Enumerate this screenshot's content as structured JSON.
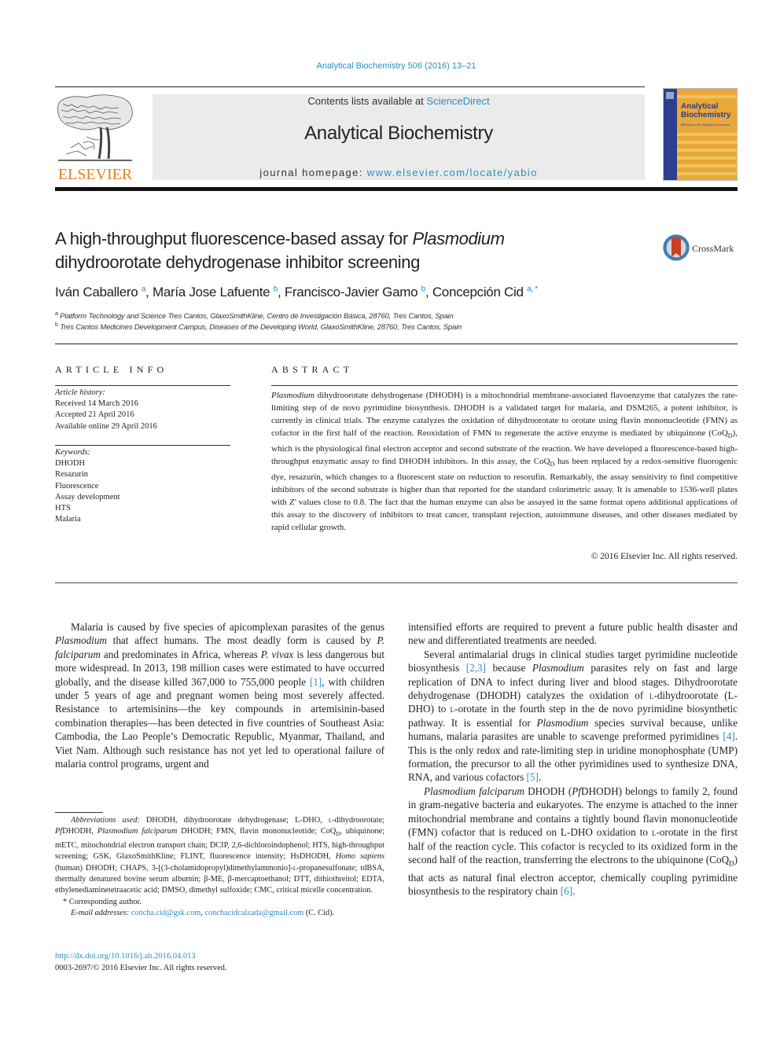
{
  "header": {
    "citation": "Analytical Biochemistry 506 (2016) 13–21",
    "publisher_logo_text": "ELSEVIER",
    "contents_prefix": "Contents lists available at ",
    "contents_link": "ScienceDirect",
    "journal_title": "Analytical Biochemistry",
    "homepage_prefix": "journal homepage: ",
    "homepage_link": "www.elsevier.com/locate/yabio",
    "cover": {
      "title_line1": "Analytical",
      "title_line2": "Biochemistry",
      "subtitle": "Methods in the Biological Sciences"
    }
  },
  "article": {
    "title_part1": "A high-throughput fluorescence-based assay for ",
    "title_italic": "Plasmodium",
    "title_part2": "dihydroorotate dehydrogenase inhibitor screening",
    "crossmark_label": "CrossMark",
    "authors": [
      {
        "name": "Iván Caballero",
        "sup": "a",
        "sep": ", "
      },
      {
        "name": "María Jose Lafuente",
        "sup": "b",
        "sep": ", "
      },
      {
        "name": "Francisco-Javier Gamo",
        "sup": "b",
        "sep": ", "
      },
      {
        "name": "Concepción Cid",
        "sup": "a, *",
        "sep": ""
      }
    ],
    "affiliations": [
      {
        "mark": "a",
        "text": "Platform Technology and Science Tres Cantos, GlaxoSmithKline, Centro de Investigación Básica, 28760, Tres Cantos, Spain"
      },
      {
        "mark": "b",
        "text": "Tres Cantos Medicines Development Campus, Diseases of the Developing World, GlaxoSmithKline, 28760, Tres Cantos, Spain"
      }
    ]
  },
  "article_info": {
    "heading": "ARTICLE INFO",
    "history_label": "Article history:",
    "received": "Received 14 March 2016",
    "accepted": "Accepted 21 April 2016",
    "online": "Available online 29 April 2016",
    "keywords_label": "Keywords:",
    "keywords": [
      "DHODH",
      "Resazurin",
      "Fluorescence",
      "Assay development",
      "HTS",
      "Malaria"
    ]
  },
  "abstract": {
    "heading": "ABSTRACT",
    "lead_italic": "Plasmodium",
    "text1": " dihydroorotate dehydrogenase (DHODH) is a mitochondrial membrane-associated flavoenzyme that catalyzes the rate-limiting step of de novo pyrimidine biosynthesis. DHODH is a validated target for malaria, and DSM265, a potent inhibitor, is currently in clinical trials. The enzyme catalyzes the oxidation of dihydroorotate to orotate using flavin mononucleotide (FMN) as cofactor in the first half of the reaction. Reoxidation of FMN to regenerate the active enzyme is mediated by ubiquinone (CoQ",
    "sub1": "D",
    "text2": "), which is the physiological final electron acceptor and second substrate of the reaction. We have developed a fluorescence-based high-throughput enzymatic assay to find DHODH inhibitors. In this assay, the CoQ",
    "sub2": "D",
    "text3": " has been replaced by a redox-sensitive fluorogenic dye, resazurin, which changes to a fluorescent state on reduction to resorufin. Remarkably, the assay sensitivity to find competitive inhibitors of the second substrate is higher than that reported for the standard colorimetric assay. It is amenable to 1536-well plates with ",
    "zprime": "Z′",
    "text4": " values close to 0.8. The fact that the human enzyme can also be assayed in the same format opens additional applications of this assay to the discovery of inhibitors to treat cancer, transplant rejection, autoimmune diseases, and other diseases mediated by rapid cellular growth.",
    "copyright": "© 2016 Elsevier Inc. All rights reserved."
  },
  "body": {
    "p1": {
      "a": "Malaria is caused by five species of apicomplexan parasites of the genus ",
      "i1": "Plasmodium",
      "b": " that affect humans. The most deadly form is caused by ",
      "i2": "P. falciparum",
      "c": " and predominates in Africa, whereas ",
      "i3": "P. vivax",
      "d": " is less dangerous but more widespread. In 2013, 198 million cases were estimated to have occurred globally, and the disease killed 367,000 to 755,000 people ",
      "ref1": "[1]",
      "e": ", with children under 5 years of age and pregnant women being most severely affected. Resistance to artemisinins—the key compounds in artemisinin-based combination therapies—has been detected in five countries of Southeast Asia: Cambodia, the Lao People’s Democratic Republic, Myanmar, Thailand, and Viet Nam. Although such resistance has not yet led to operational failure of malaria control programs, urgent and intensified efforts are required to prevent a future public health disaster and new and differentiated treatments are needed."
    },
    "p1_col1": "Malaria is caused by five species of apicomplexan parasites of the genus ",
    "p1_col2": "intensified efforts are required to prevent a future public health disaster and new and differentiated treatments are needed.",
    "p2": {
      "a": "Several antimalarial drugs in clinical studies target pyrimidine nucleotide biosynthesis ",
      "ref": "[2,3]",
      "b": " because ",
      "i1": "Plasmodium",
      "c": " parasites rely on fast and large replication of DNA to infect during liver and blood stages. Dihydroorotate dehydrogenase (DHODH) catalyzes the oxidation of ",
      "sc1": "l",
      "d": "-dihydroorotate (L-DHO) to ",
      "sc2": "l",
      "e": "-orotate in the fourth step in the de novo pyrimidine biosynthetic pathway. It is essential for ",
      "i2": "Plasmodium",
      "f": " species survival because, unlike humans, malaria parasites are unable to scavenge preformed pyrimidines ",
      "ref2": "[4]",
      "g": ". This is the only redox and rate-limiting step in uridine monophosphate (UMP) formation, the precursor to all the other pyrimidines used to synthesize DNA, RNA, and various cofactors ",
      "ref3": "[5]",
      "h": "."
    },
    "p3": {
      "i1": "Plasmodium falciparum",
      "a": " DHODH (",
      "i2": "Pf",
      "b": "DHODH) belongs to family 2, found in gram-negative bacteria and eukaryotes. The enzyme is attached to the inner mitochondrial membrane and contains a tightly bound flavin mononucleotide (FMN) cofactor that is reduced on L-DHO oxidation to ",
      "sc": "l",
      "c": "-orotate in the first half of the reaction cycle. This cofactor is recycled to its oxidized form in the second half of the reaction, transferring the electrons to the ubiquinone (CoQ",
      "sub": "D",
      "d": ") that acts as natural final electron acceptor, chemically coupling pyrimidine biosynthesis to the respiratory chain ",
      "ref": "[6]",
      "e": "."
    }
  },
  "footnotes": {
    "abbrev_label": "Abbreviations used:",
    "abbrev_a": " DHODH, dihydroorotate dehydrogenase; L-DHO, ",
    "abbrev_sc": "l",
    "abbrev_b": "-dihydroorotate; ",
    "abbrev_pf": "Pf",
    "abbrev_c": "DHODH, ",
    "abbrev_pfi": "Plasmodium falciparum",
    "abbrev_d": " DHODH; FMN, flavin mononucleotide; CoQ",
    "abbrev_sub": "D",
    "abbrev_e": ", ubiquinone; mETC, mitochondrial electron transport chain; DCIP, 2,6-dichloroindophenol; HTS, high-throughput screening; GSK, GlaxoSmithKline; FLINT, fluorescence intensity; HsDHODH, ",
    "abbrev_hs": "Homo sapiens",
    "abbrev_f": " (human) DHODH; CHAPS, 3-[(3-cholamidopropyl)dimethylammonio]-",
    "abbrev_sc2": "l",
    "abbrev_g": "-propanesulfonate; tdBSA, thermally denatured bovine serum albumin; β-ME, β-mercaptoethanol; DTT, dithiothreitol; EDTA, ethylenediaminetetraacetic acid; DMSO, dimethyl sulfoxide; CMC, critical micelle concentration.",
    "corresponding": "* Corresponding author.",
    "email_label": "E-mail addresses:",
    "email1": "concha.cid@gsk.com",
    "email_sep": ", ",
    "email2": "conchacidcalzada@gmail.com",
    "email_suffix": " (C. Cid).",
    "doi": "http://dx.doi.org/10.1016/j.ab.2016.04.013",
    "issn": "0003-2697/© 2016 Elsevier Inc. All rights reserved."
  },
  "colors": {
    "link": "#2a8ec2",
    "elsevier_orange": "#e8801f",
    "banner_bg": "#ebebeb",
    "cover_gold": "#e9a83a",
    "cover_blue": "#2b3f8e"
  }
}
